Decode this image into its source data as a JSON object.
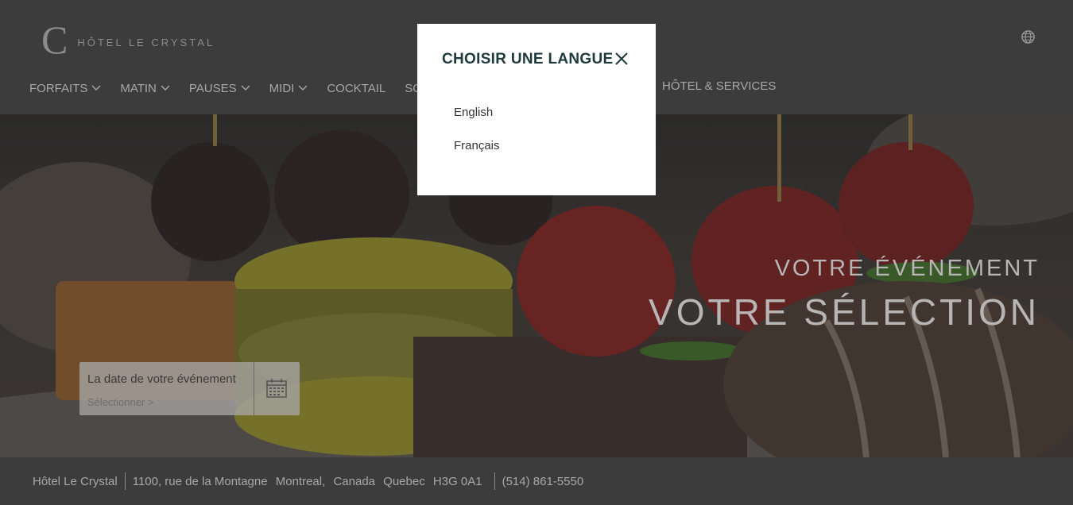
{
  "header": {
    "logo_letter": "C",
    "logo_text": "HÔTEL LE CRYSTAL",
    "nav": [
      {
        "label": "FORFAITS",
        "dropdown": true
      },
      {
        "label": "MATIN",
        "dropdown": true
      },
      {
        "label": "PAUSES",
        "dropdown": true
      },
      {
        "label": "MIDI",
        "dropdown": true
      },
      {
        "label": "COCKTAIL",
        "dropdown": false
      },
      {
        "label": "SO",
        "dropdown": false
      }
    ],
    "nav_right": "HÔTEL & SERVICES",
    "globe_icon": "globe-icon"
  },
  "hero": {
    "subtitle": "VOTRE ÉVÉNEMENT",
    "title": "VOTRE SÉLECTION",
    "date_label": "La date de votre événement",
    "date_select": "Sélectionner >",
    "calendar_icon": "calendar-icon"
  },
  "footer": {
    "name": "Hôtel Le Crystal",
    "address": [
      "1100, rue de la Montagne",
      "Montreal,",
      "Canada",
      "Quebec",
      "H3G 0A1"
    ],
    "phone": "(514) 861-5550"
  },
  "modal": {
    "title": "CHOISIR UNE LANGUE",
    "close_icon": "close-icon",
    "languages": [
      "English",
      "Français"
    ]
  },
  "colors": {
    "header_bg": "#3c3c3c",
    "modal_title": "#1f3a3c",
    "nav_text": "#a8a8a8"
  }
}
